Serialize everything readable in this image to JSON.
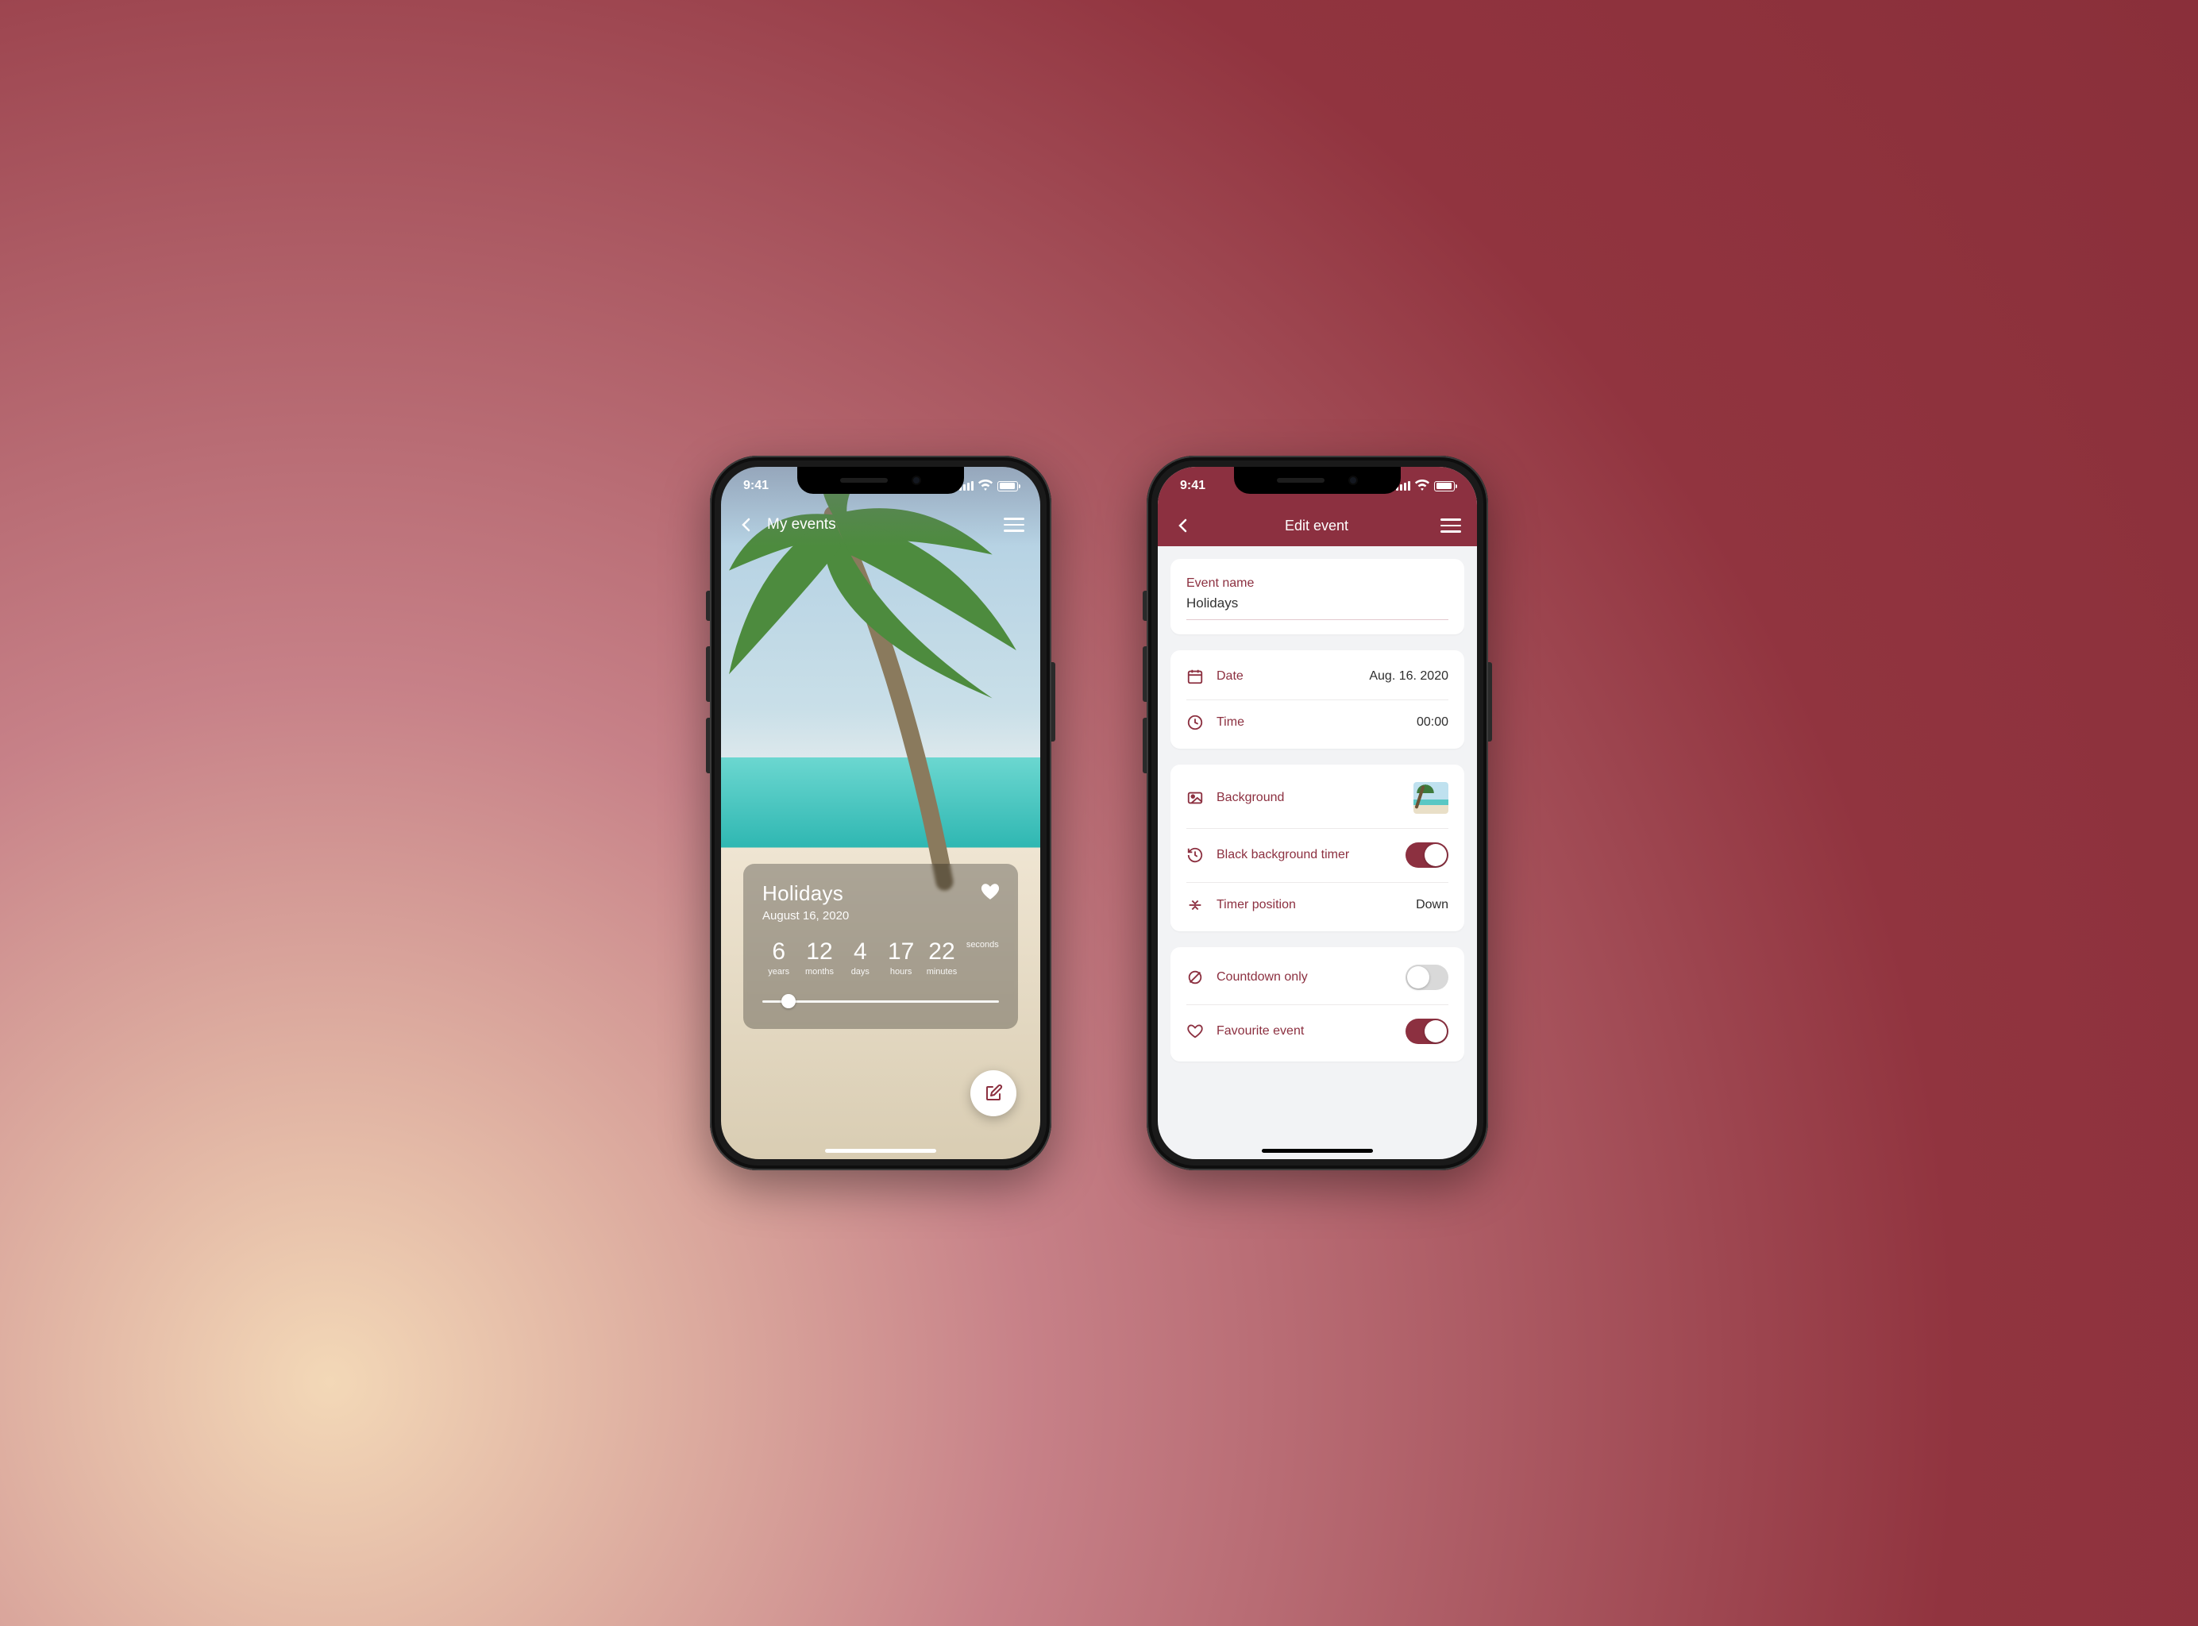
{
  "accent": "#8c3040",
  "statusbar": {
    "time": "9:41"
  },
  "left": {
    "nav_title": "My events",
    "event": {
      "title": "Holidays",
      "date_display": "August 16, 2020",
      "favourite": true,
      "countdown": [
        {
          "value": "6",
          "label": "years"
        },
        {
          "value": "12",
          "label": "months"
        },
        {
          "value": "4",
          "label": "days"
        },
        {
          "value": "17",
          "label": "hours"
        },
        {
          "value": "22",
          "label": "minutes"
        },
        {
          "value": "",
          "label": "seconds"
        }
      ],
      "slider_position_pct": 8
    },
    "fab_icon": "edit-icon"
  },
  "right": {
    "nav_title": "Edit event",
    "sections": {
      "name": {
        "label": "Event name",
        "value": "Holidays"
      },
      "date": {
        "label": "Date",
        "value": "Aug. 16. 2020",
        "icon": "calendar-icon"
      },
      "time": {
        "label": "Time",
        "value": "00:00",
        "icon": "clock-icon"
      },
      "background": {
        "label": "Background",
        "icon": "image-icon"
      },
      "black_bg_timer": {
        "label": "Black background timer",
        "icon": "history-icon",
        "on": true
      },
      "timer_position": {
        "label": "Timer position",
        "value": "Down",
        "icon": "align-icon"
      },
      "countdown_only": {
        "label": "Countdown only",
        "icon": "no-eye-icon",
        "on": false
      },
      "favourite_event": {
        "label": "Favourite event",
        "icon": "heart-outline-icon",
        "on": true
      }
    }
  }
}
